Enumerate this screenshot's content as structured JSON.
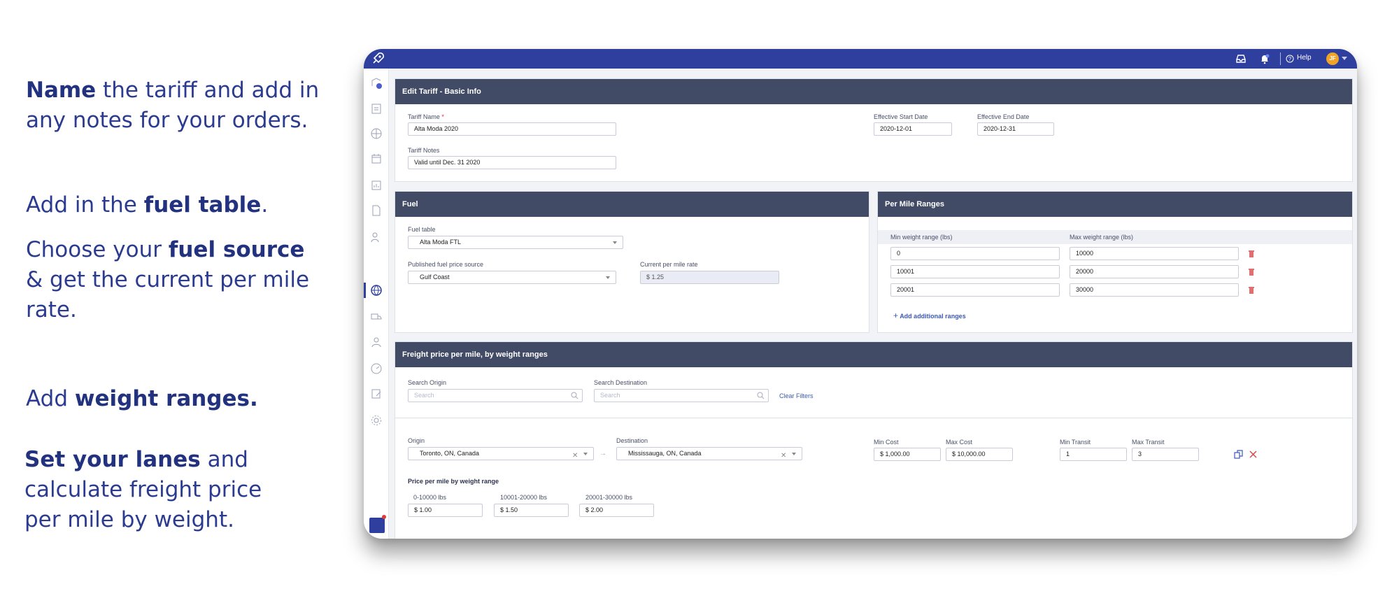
{
  "annotations": {
    "name": {
      "bold": "Name",
      "rest": " the tariff and add in any notes for your orders."
    },
    "fuel_table": {
      "pre": "Add in the ",
      "bold": "fuel table",
      "post": "."
    },
    "fuel_source": {
      "pre": "Choose your ",
      "bold": "fuel source",
      "post": " & get the current per mile rate."
    },
    "weight": {
      "pre": "Add ",
      "bold": "weight ranges."
    },
    "lanes": {
      "bold": "Set your lanes",
      "rest": " and calculate freight price per mile by weight."
    }
  },
  "topbar": {
    "help_label": "Help",
    "avatar_initials": "JF"
  },
  "basic_info": {
    "title": "Edit Tariff - Basic Info",
    "tariff_name_label": "Tariff Name",
    "required_mark": "*",
    "tariff_name_value": "Alta Moda 2020",
    "tariff_notes_label": "Tariff Notes",
    "tariff_notes_value": "Valid until Dec. 31 2020",
    "start_label": "Effective Start Date",
    "start_value": "2020-12-01",
    "end_label": "Effective End Date",
    "end_value": "2020-12-31"
  },
  "fuel": {
    "title": "Fuel",
    "table_label": "Fuel table",
    "table_value": "Alta Moda FTL",
    "source_label": "Published fuel price source",
    "source_value": "Gulf Coast",
    "rate_label": "Current per mile rate",
    "rate_value": "$ 1.25"
  },
  "per_mile": {
    "title": "Per Mile Ranges",
    "min_label": "Min weight range (lbs)",
    "max_label": "Max weight range (lbs)",
    "ranges": [
      {
        "min": "0",
        "max": "10000"
      },
      {
        "min": "10001",
        "max": "20000"
      },
      {
        "min": "20001",
        "max": "30000"
      }
    ],
    "add_label": "Add additional ranges"
  },
  "freight": {
    "title": "Freight price per mile, by weight ranges",
    "origin_search_label": "Search Origin",
    "origin_search_placeholder": "Search",
    "dest_search_label": "Search Destination",
    "dest_search_placeholder": "Search",
    "clear_filters": "Clear Filters",
    "origin_label": "Origin",
    "origin_value": "Toronto, ON, Canada",
    "arrow": "→",
    "destination_label": "Destination",
    "destination_value": "Mississauga, ON, Canada",
    "min_cost_label": "Min Cost",
    "min_cost_value": "$ 1,000.00",
    "max_cost_label": "Max Cost",
    "max_cost_value": "$ 10,000.00",
    "min_transit_label": "Min Transit",
    "min_transit_value": "1",
    "max_transit_label": "Max Transit",
    "max_transit_value": "3",
    "price_heading": "Price per mile by weight range",
    "prices": [
      {
        "label": "0-10000 lbs",
        "value": "$ 1.00"
      },
      {
        "label": "10001-20000 lbs",
        "value": "$ 1.50"
      },
      {
        "label": "20001-30000 lbs",
        "value": "$ 2.00"
      }
    ]
  },
  "colors": {
    "topbar": "#2f3f9e",
    "panel_header": "#414b66",
    "accent_text": "#2b3b8f",
    "danger": "#e23b3b"
  }
}
